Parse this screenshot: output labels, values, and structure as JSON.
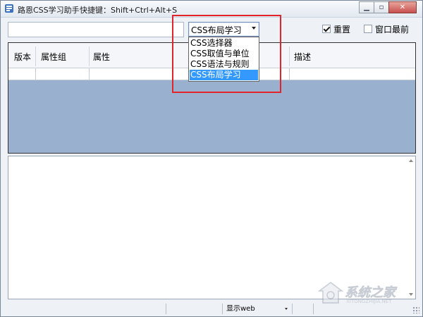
{
  "window": {
    "title": "路恩CSS学习助手",
    "shortcut": "快捷键：Shift+Ctrl+Alt+S"
  },
  "toolbar": {
    "search_value": "",
    "combo_value": "CSS布局学习",
    "reset_label": "重置",
    "reset_checked": true,
    "topmost_label": "窗口最前",
    "topmost_checked": false
  },
  "dropdown": {
    "items": [
      "CSS选择器",
      "CSS取值与单位",
      "CSS语法与规则",
      "CSS布局学习"
    ],
    "selected_index": 3
  },
  "grid": {
    "columns": [
      "版本",
      "属性组",
      "属性",
      "",
      "描述"
    ]
  },
  "statusbar": {
    "display_mode": "显示web"
  },
  "watermark": {
    "text": "系统之家",
    "url": "XITONGZHIJIA.NET"
  },
  "colors": {
    "highlight": "#e0242a",
    "selection": "#3399ff",
    "grid_background": "#99b1cf"
  }
}
